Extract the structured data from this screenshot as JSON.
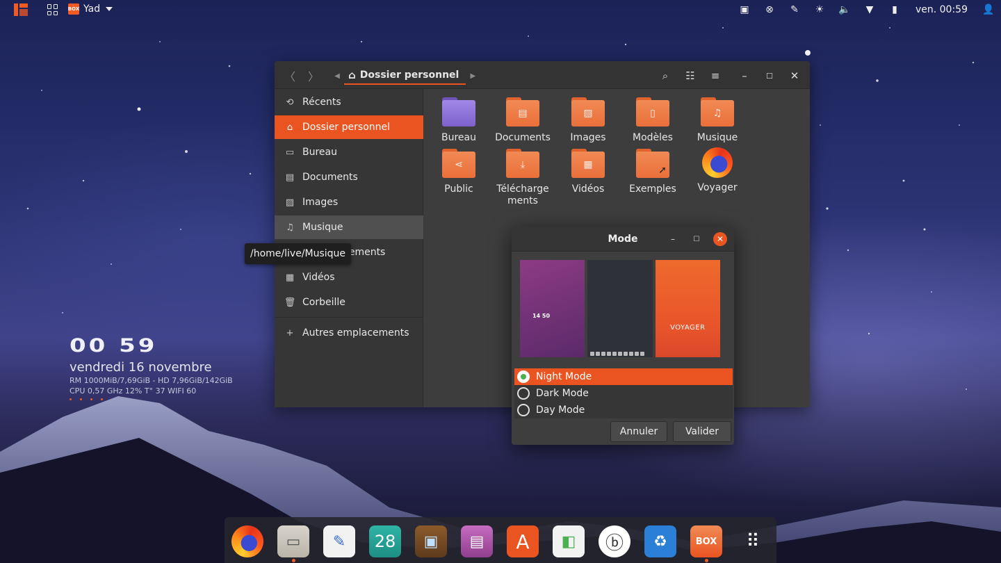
{
  "topbar": {
    "app_name": "Yad",
    "app_icon_text": "BOX",
    "clock": "ven. 00:59"
  },
  "conky": {
    "time": "00 59",
    "date": "vendredi 16 novembre",
    "line1": "RM 1000MiB/7,69GiB - HD 7,96GiB/142GiB",
    "line2": "CPU 0,57 GHz 12% T° 37  WIFI 60"
  },
  "files": {
    "path": "Dossier personnel",
    "sidebar": [
      {
        "label": "Récents",
        "icon": "clock-icon"
      },
      {
        "label": "Dossier personnel",
        "icon": "home-icon"
      },
      {
        "label": "Bureau",
        "icon": "desktop-icon"
      },
      {
        "label": "Documents",
        "icon": "document-icon"
      },
      {
        "label": "Images",
        "icon": "image-icon"
      },
      {
        "label": "Musique",
        "icon": "music-icon"
      },
      {
        "label": "Téléchargements",
        "icon": "download-icon"
      },
      {
        "label": "Vidéos",
        "icon": "video-icon"
      },
      {
        "label": "Corbeille",
        "icon": "trash-icon"
      }
    ],
    "other_locations": "Autres emplacements",
    "items": [
      {
        "label": "Bureau",
        "type": "purple-folder"
      },
      {
        "label": "Documents",
        "type": "documents-folder"
      },
      {
        "label": "Images",
        "type": "images-folder"
      },
      {
        "label": "Modèles",
        "type": "templates-folder"
      },
      {
        "label": "Musique",
        "type": "music-folder"
      },
      {
        "label": "Public",
        "type": "share-folder"
      },
      {
        "label1": "Télécharge",
        "label2": "ments",
        "type": "download-folder"
      },
      {
        "label": "Vidéos",
        "type": "video-folder"
      },
      {
        "label": "Exemples",
        "type": "link-folder"
      },
      {
        "label": "Voyager",
        "type": "firefox-launcher"
      }
    ],
    "tooltip": "/home/live/Musique"
  },
  "dialog": {
    "title": "Mode",
    "preview_clock": "14 50",
    "preview_brand": "VOYAGER",
    "options": [
      "Night Mode",
      "Dark Mode",
      "Day Mode"
    ],
    "selected": "Night Mode",
    "cancel": "Annuler",
    "ok": "Valider"
  },
  "dock": {
    "calendar_day": "28",
    "box_label": "BOX",
    "apps": [
      "firefox-icon",
      "files-icon",
      "text-editor-icon",
      "calendar-icon",
      "tv-icon",
      "video-player-icon",
      "app-store-icon",
      "settings-toggle-icon",
      "browser-b-icon",
      "recycle-icon",
      "box-icon",
      "app-grid-icon"
    ]
  },
  "colors": {
    "accent": "#e95420",
    "window_bg": "#3b3b3b",
    "header_bg": "#333333"
  }
}
